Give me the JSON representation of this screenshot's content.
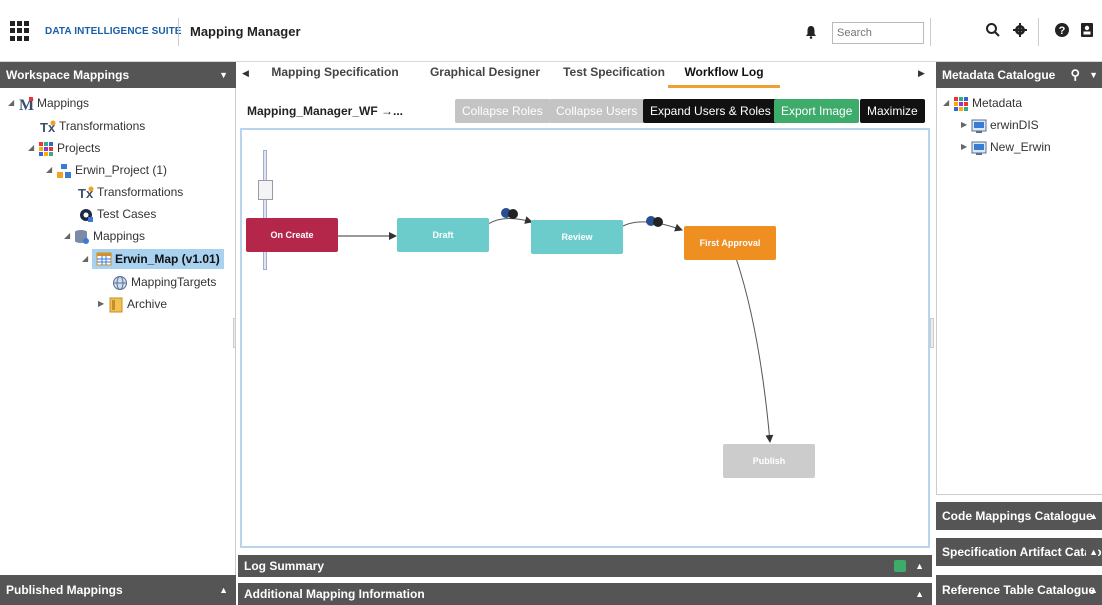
{
  "header": {
    "brand": "DATA INTELLIGENCE SUITE",
    "app_title": "Mapping Manager",
    "search_placeholder": "Search"
  },
  "left_panel": {
    "title": "Workspace Mappings",
    "tree": [
      {
        "label": "Mappings"
      },
      {
        "label": "Transformations"
      },
      {
        "label": "Projects"
      },
      {
        "label": "Erwin_Project (1)"
      },
      {
        "label": "Transformations"
      },
      {
        "label": "Test Cases"
      },
      {
        "label": "Mappings"
      },
      {
        "label": "Erwin_Map (v1.01)"
      },
      {
        "label": "MappingTargets"
      },
      {
        "label": "Archive"
      }
    ],
    "footer": "Published Mappings"
  },
  "tabs": [
    {
      "label": "Mapping Specification"
    },
    {
      "label": "Graphical Designer"
    },
    {
      "label": "Test Specification"
    },
    {
      "label": "Workflow Log"
    }
  ],
  "toolbar": {
    "workflow_name": "Mapping_Manager_WF →...",
    "collapse_roles": "Collapse Roles",
    "collapse_users": "Collapse Users",
    "expand_users_roles": "Expand Users & Roles",
    "export_image": "Export Image",
    "maximize": "Maximize"
  },
  "workflow": {
    "nodes": [
      {
        "label": "On Create",
        "color": "#b5264b"
      },
      {
        "label": "Draft",
        "color": "#6ccccc"
      },
      {
        "label": "Review",
        "color": "#6ccccc"
      },
      {
        "label": "First Approval",
        "color": "#ef8f22"
      },
      {
        "label": "Publish",
        "color": "#cccccc"
      }
    ]
  },
  "bottom": {
    "log_summary": "Log Summary",
    "additional_info": "Additional Mapping Information"
  },
  "right_panel": {
    "title": "Metadata Catalogue",
    "tree": [
      {
        "label": "Metadata"
      },
      {
        "label": "erwinDIS"
      },
      {
        "label": "New_Erwin"
      }
    ],
    "sections": [
      {
        "label": "Code Mappings Catalogue"
      },
      {
        "label": "Specification Artifact Catalo"
      },
      {
        "label": "Reference Table Catalogue"
      }
    ]
  }
}
